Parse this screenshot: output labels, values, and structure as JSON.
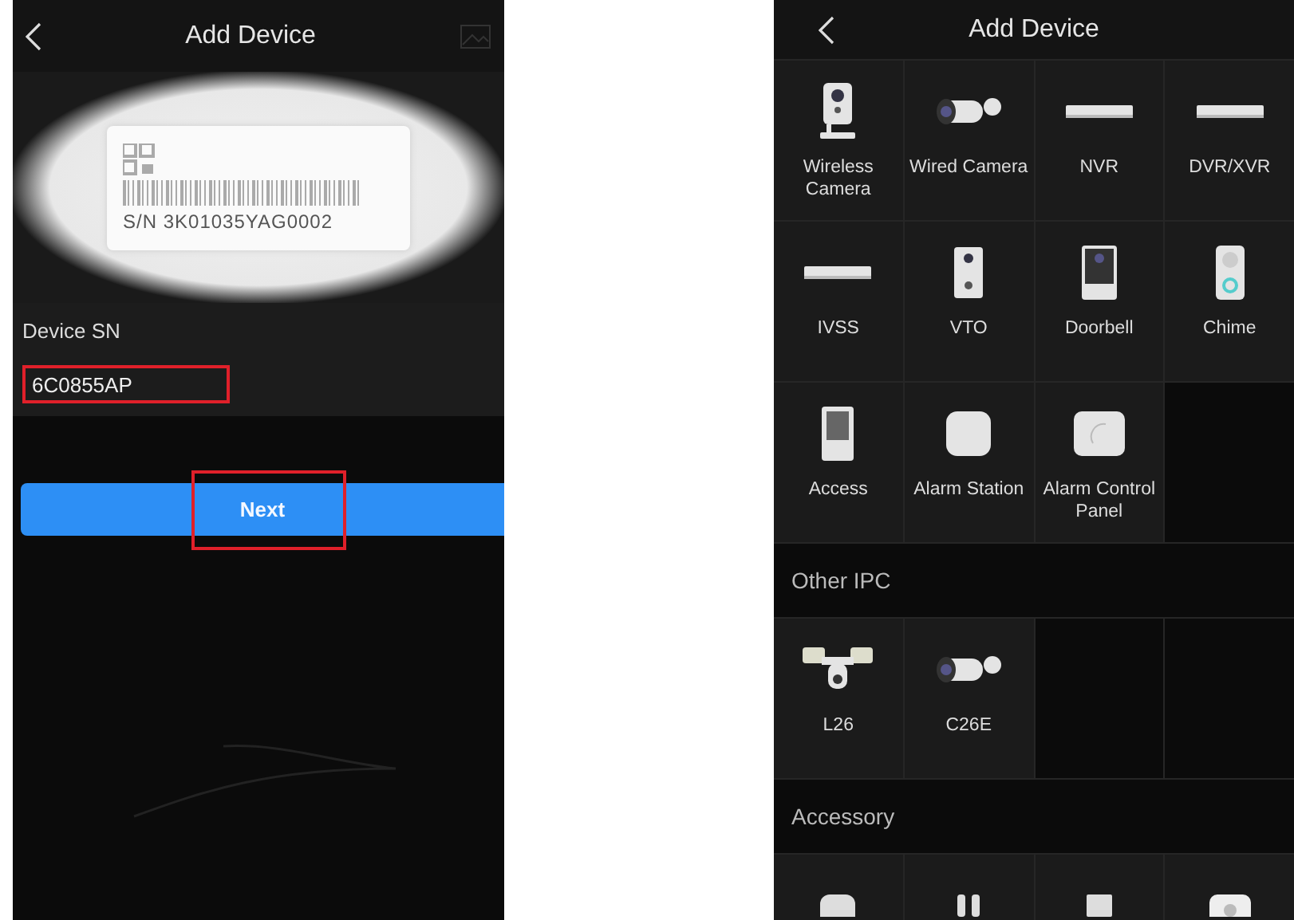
{
  "left_screen": {
    "header": {
      "title": "Add Device"
    },
    "preview": {
      "label_text": "S/N  3K01035YAG0002"
    },
    "sn_section": {
      "label": "Device SN",
      "value": "6C0855AP",
      "highlighted": true
    },
    "next_button": {
      "label": "Next",
      "highlighted": true
    }
  },
  "right_screen": {
    "header": {
      "title": "Add Device"
    },
    "sections": [
      {
        "items": [
          {
            "kind": "cube-camera",
            "label": "Wireless Camera"
          },
          {
            "kind": "bullet-camera",
            "label": "Wired Camera"
          },
          {
            "kind": "recorder",
            "label": "NVR"
          },
          {
            "kind": "recorder",
            "label": "DVR/XVR"
          },
          {
            "kind": "recorder",
            "label": "IVSS"
          },
          {
            "kind": "intercom",
            "label": "VTO"
          },
          {
            "kind": "doorbell",
            "label": "Doorbell"
          },
          {
            "kind": "chime",
            "label": "Chime"
          },
          {
            "kind": "access",
            "label": "Access"
          },
          {
            "kind": "hub",
            "label": "Alarm Station"
          },
          {
            "kind": "panel",
            "label": "Alarm Control Panel"
          }
        ]
      },
      {
        "title": "Other IPC",
        "items": [
          {
            "kind": "floodlight",
            "label": "L26"
          },
          {
            "kind": "bullet-camera",
            "label": "C26E"
          }
        ]
      },
      {
        "title": "Accessory",
        "items": [
          {
            "kind": "sensor"
          },
          {
            "kind": "siren"
          },
          {
            "kind": "contact"
          },
          {
            "kind": "detector"
          }
        ]
      }
    ]
  }
}
